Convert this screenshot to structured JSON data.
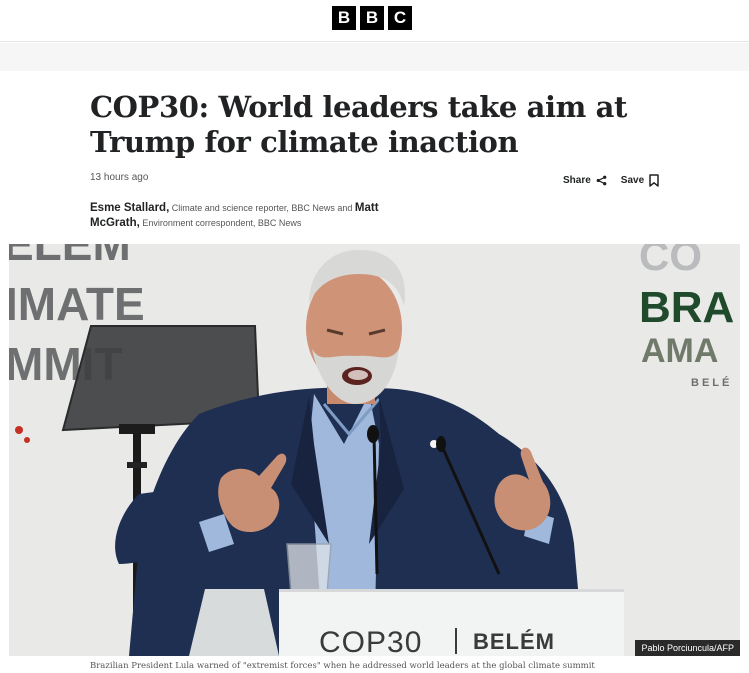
{
  "brand": {
    "letters": [
      "B",
      "B",
      "C"
    ]
  },
  "article": {
    "headline": "COP30: World leaders take aim at Trump for climate inaction",
    "timestamp": "13 hours ago",
    "share_label": "Share",
    "save_label": "Save",
    "byline": {
      "author1_name": "Esme Stallard,",
      "author1_role": "Climate and science reporter, BBC News and",
      "author2_name": "Matt McGrath,",
      "author2_role": "Environment correspondent, BBC News"
    },
    "image": {
      "credit": "Pablo Porciuncula/AFP",
      "caption": "Brazilian President Lula warned of \"extremist forces\" when he addressed world leaders at the global climate summit",
      "backdrop_text_left": [
        "ELEM",
        "IMATE",
        "MMIT"
      ],
      "backdrop_text_right": [
        "CO",
        "BRA",
        "AMA",
        "BELÉ"
      ],
      "podium_text_left": "COP30",
      "podium_text_right": "BELÉM"
    }
  },
  "colors": {
    "accent": "#000000",
    "backdrop": "#e9e9e7",
    "podium": "#f2f3f3",
    "suit": "#1f2f52"
  }
}
